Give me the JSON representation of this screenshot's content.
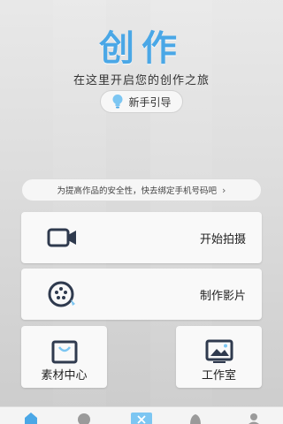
{
  "header": {
    "title": "创作",
    "subtitle": "在这里开启您的创作之旅",
    "guide_button_label": "新手引导"
  },
  "notice": {
    "text": "为提高作品的安全性，快去绑定手机号码吧",
    "chevron": "›"
  },
  "actions": {
    "start_shooting": "开始拍摄",
    "make_film": "制作影片",
    "material_center": "素材中心",
    "studio": "工作室"
  },
  "icons": {
    "guide": "lightbulb-icon",
    "start_shooting": "video-camera-icon",
    "make_film": "film-reel-icon",
    "material_center": "shopping-bag-icon",
    "studio": "picture-icon"
  },
  "colors": {
    "accent": "#4aa7e6",
    "icon_dark": "#2f3a4e"
  }
}
